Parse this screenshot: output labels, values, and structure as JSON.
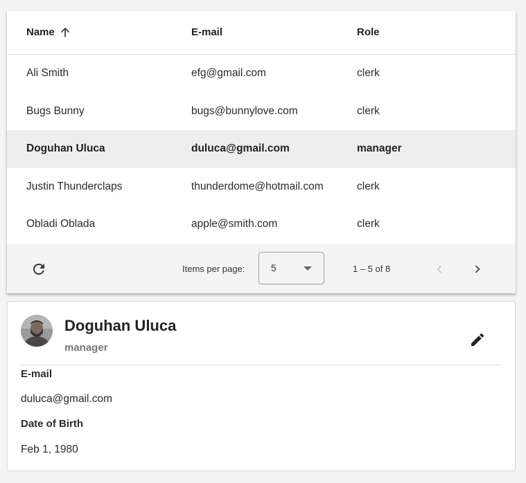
{
  "table": {
    "columns": [
      "Name",
      "E-mail",
      "Role"
    ],
    "sort": {
      "column": "Name",
      "direction": "ascending",
      "icon": "arrow-up-icon"
    },
    "rows": [
      {
        "name": "Ali Smith",
        "email": "efg@gmail.com",
        "role": "clerk",
        "selected": false
      },
      {
        "name": "Bugs Bunny",
        "email": "bugs@bunnylove.com",
        "role": "clerk",
        "selected": false
      },
      {
        "name": "Doguhan Uluca",
        "email": "duluca@gmail.com",
        "role": "manager",
        "selected": true
      },
      {
        "name": "Justin Thunderclaps",
        "email": "thunderdome@hotmail.com",
        "role": "clerk",
        "selected": false
      },
      {
        "name": "Obladi Oblada",
        "email": "apple@smith.com",
        "role": "clerk",
        "selected": false
      }
    ]
  },
  "paginator": {
    "refresh_icon": "refresh-icon",
    "items_per_page_label": "Items per page:",
    "items_per_page_value": "5",
    "range_label": "1 – 5 of 8",
    "prev_icon": "chevron-left-icon",
    "next_icon": "chevron-right-icon",
    "prev_disabled": true,
    "next_disabled": false
  },
  "detail": {
    "name": "Doguhan Uluca",
    "role": "manager",
    "edit_icon": "pencil-icon",
    "email_label": "E-mail",
    "email_value": "duluca@gmail.com",
    "dob_label": "Date of Birth",
    "dob_value": "Feb 1, 1980"
  },
  "colors": {
    "background": "#f4f4f4",
    "card": "#ffffff",
    "selected_row": "#eeeeee",
    "text": "#212121",
    "muted": "#777777"
  }
}
